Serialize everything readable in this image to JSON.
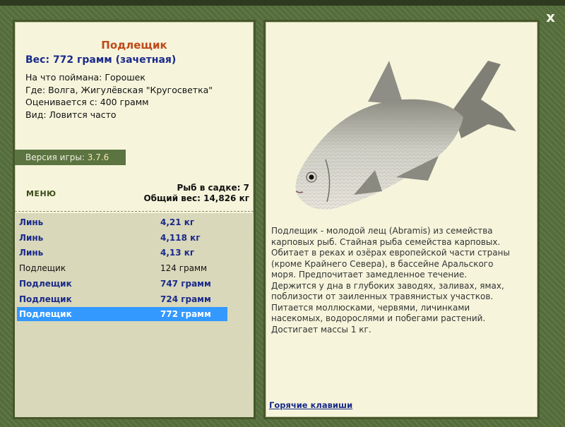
{
  "close_label": "x",
  "fish": {
    "name": "Подлещик",
    "weight_line": "Вес: 772 грамм (зачетная)",
    "caught_on": "На что поймана: Горошек",
    "location": "Где: Волга, Жигулёвская \"Кругосветка\"",
    "rated_from": "Оценивается с: 400 грамм",
    "type": "Вид: Ловится часто"
  },
  "version": {
    "label": "Версия игры:",
    "value": "3.7.6"
  },
  "menu_label": "МЕНЮ",
  "summary": {
    "fish_in_net": "Рыб в садке: 7",
    "total_weight": "Общий вес: 14,826 кг"
  },
  "catch_list": [
    {
      "name": "Линь",
      "weight": "4,21 кг",
      "style": "bold"
    },
    {
      "name": "Линь",
      "weight": "4,118 кг",
      "style": "bold"
    },
    {
      "name": "Линь",
      "weight": "4,13 кг",
      "style": "bold"
    },
    {
      "name": "Подлещик",
      "weight": "124 грамм",
      "style": "plain"
    },
    {
      "name": "Подлещик",
      "weight": "747 грамм",
      "style": "bold"
    },
    {
      "name": "Подлещик",
      "weight": "724 грамм",
      "style": "bold"
    },
    {
      "name": "Подлещик",
      "weight": "772 грамм",
      "style": "selected"
    }
  ],
  "description": "Подлещик - молодой лещ (Abramis) из семейства карповых рыб. Стайная рыба семейства карповых. Обитает в реках и озёрах европейской части страны (кроме Крайнего Севера), в бассейне Аральского моря. Предпочитает замедленное течение. Держится у дна в глубоких заводях, заливах, ямах, поблизости от заиленных травянистых участков. Питается моллюсками, червями, личинками насекомых, водорослями и побегами растений. Достигает массы 1 кг.",
  "hotkeys_label": "Горячие клавиши"
}
